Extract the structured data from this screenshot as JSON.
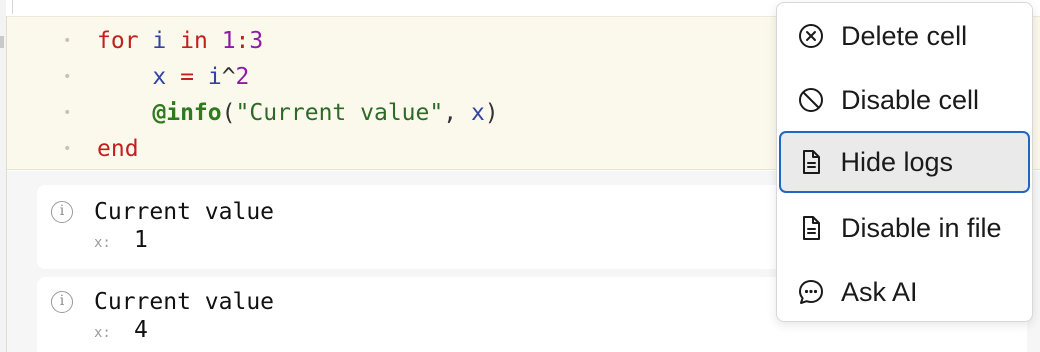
{
  "code": {
    "line1": {
      "kw_for": "for",
      "var_i": "i",
      "kw_in": "in",
      "range_start": "1",
      "colon": ":",
      "range_end": "3"
    },
    "line2": {
      "var_x": "x",
      "eq": "=",
      "var_i": "i",
      "caret": "^",
      "exp": "2"
    },
    "line3": {
      "macro": "@info",
      "open": "(",
      "str": "\"Current value\"",
      "comma": ",",
      "var_x": "x",
      "close": ")"
    },
    "line4": {
      "kw_end": "end"
    },
    "gutter_marker": "•"
  },
  "logs": [
    {
      "message": "Current value",
      "key": "x:",
      "value": "1"
    },
    {
      "message": "Current value",
      "key": "x:",
      "value": "4"
    }
  ],
  "context_menu": {
    "items": [
      {
        "label": "Delete cell",
        "icon": "circle-x-icon"
      },
      {
        "label": "Disable cell",
        "icon": "circle-slash-icon"
      },
      {
        "label": "Hide logs",
        "icon": "document-lines-icon"
      },
      {
        "label": "Disable in file",
        "icon": "document-lines-icon"
      },
      {
        "label": "Ask AI",
        "icon": "chat-bubble-icon"
      }
    ],
    "highlighted": "Hide logs"
  },
  "colors": {
    "code_bg": "#fbf8ec",
    "keyword": "#c2201d",
    "variable": "#2f44a6",
    "number": "#8e1ba6",
    "macro": "#2d7a1f",
    "focus_ring": "#2266c4"
  }
}
